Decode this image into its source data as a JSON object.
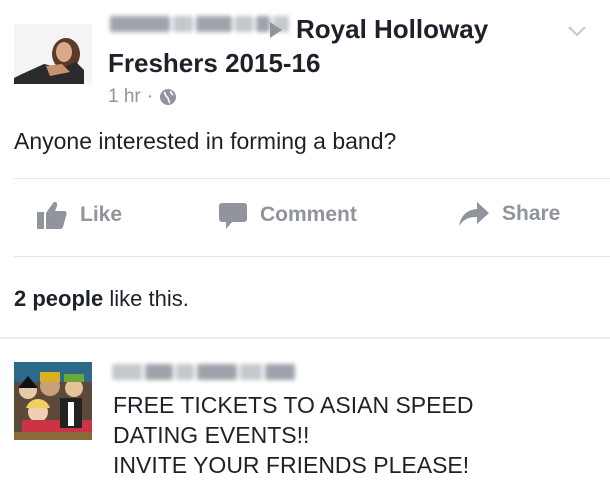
{
  "post": {
    "group_name_line1": "Royal Holloway",
    "group_name_line2": "Freshers 2015-16",
    "time": "1 hr",
    "separator": "·",
    "privacy_icon": "globe-icon",
    "menu_icon": "chevron-down-icon",
    "text": "Anyone interested in forming a band?"
  },
  "actions": {
    "like_label": "Like",
    "comment_label": "Comment",
    "share_label": "Share"
  },
  "likes": {
    "count_text": "2 people",
    "suffix": " like this."
  },
  "comment": {
    "lines": [
      "FREE TICKETS TO ASIAN SPEED",
      "DATING EVENTS!!",
      "INVITE YOUR FRIENDS PLEASE!"
    ]
  },
  "colors": {
    "text": "#1d2129",
    "muted": "#90949c",
    "divider": "#e5e5e5"
  }
}
